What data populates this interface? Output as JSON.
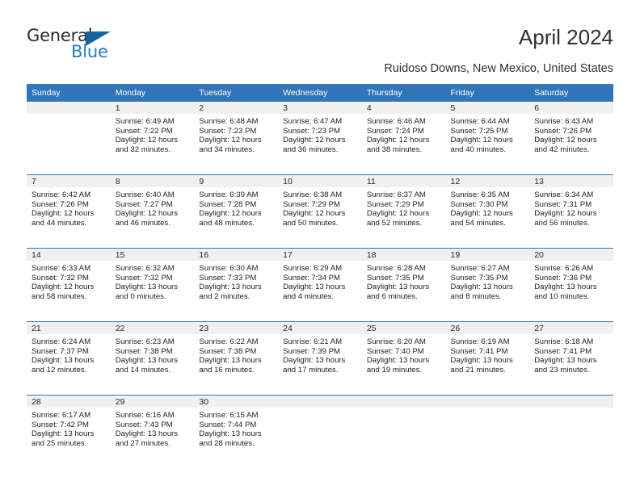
{
  "brand": {
    "name_part1": "General",
    "name_part2": "Blue",
    "accent_color": "#1464a5"
  },
  "header": {
    "title": "April 2024",
    "location": "Ruidoso Downs, New Mexico, United States"
  },
  "calendar": {
    "header_bg": "#3076b8",
    "weekday_headers": [
      "Sunday",
      "Monday",
      "Tuesday",
      "Wednesday",
      "Thursday",
      "Friday",
      "Saturday"
    ],
    "weeks": [
      [
        {
          "day": "",
          "sunrise": "",
          "sunset": "",
          "daylight_line1": "",
          "daylight_line2": ""
        },
        {
          "day": "1",
          "sunrise": "Sunrise: 6:49 AM",
          "sunset": "Sunset: 7:22 PM",
          "daylight_line1": "Daylight: 12 hours",
          "daylight_line2": "and 32 minutes."
        },
        {
          "day": "2",
          "sunrise": "Sunrise: 6:48 AM",
          "sunset": "Sunset: 7:23 PM",
          "daylight_line1": "Daylight: 12 hours",
          "daylight_line2": "and 34 minutes."
        },
        {
          "day": "3",
          "sunrise": "Sunrise: 6:47 AM",
          "sunset": "Sunset: 7:23 PM",
          "daylight_line1": "Daylight: 12 hours",
          "daylight_line2": "and 36 minutes."
        },
        {
          "day": "4",
          "sunrise": "Sunrise: 6:46 AM",
          "sunset": "Sunset: 7:24 PM",
          "daylight_line1": "Daylight: 12 hours",
          "daylight_line2": "and 38 minutes."
        },
        {
          "day": "5",
          "sunrise": "Sunrise: 6:44 AM",
          "sunset": "Sunset: 7:25 PM",
          "daylight_line1": "Daylight: 12 hours",
          "daylight_line2": "and 40 minutes."
        },
        {
          "day": "6",
          "sunrise": "Sunrise: 6:43 AM",
          "sunset": "Sunset: 7:26 PM",
          "daylight_line1": "Daylight: 12 hours",
          "daylight_line2": "and 42 minutes."
        }
      ],
      [
        {
          "day": "7",
          "sunrise": "Sunrise: 6:42 AM",
          "sunset": "Sunset: 7:26 PM",
          "daylight_line1": "Daylight: 12 hours",
          "daylight_line2": "and 44 minutes."
        },
        {
          "day": "8",
          "sunrise": "Sunrise: 6:40 AM",
          "sunset": "Sunset: 7:27 PM",
          "daylight_line1": "Daylight: 12 hours",
          "daylight_line2": "and 46 minutes."
        },
        {
          "day": "9",
          "sunrise": "Sunrise: 6:39 AM",
          "sunset": "Sunset: 7:28 PM",
          "daylight_line1": "Daylight: 12 hours",
          "daylight_line2": "and 48 minutes."
        },
        {
          "day": "10",
          "sunrise": "Sunrise: 6:38 AM",
          "sunset": "Sunset: 7:29 PM",
          "daylight_line1": "Daylight: 12 hours",
          "daylight_line2": "and 50 minutes."
        },
        {
          "day": "11",
          "sunrise": "Sunrise: 6:37 AM",
          "sunset": "Sunset: 7:29 PM",
          "daylight_line1": "Daylight: 12 hours",
          "daylight_line2": "and 52 minutes."
        },
        {
          "day": "12",
          "sunrise": "Sunrise: 6:35 AM",
          "sunset": "Sunset: 7:30 PM",
          "daylight_line1": "Daylight: 12 hours",
          "daylight_line2": "and 54 minutes."
        },
        {
          "day": "13",
          "sunrise": "Sunrise: 6:34 AM",
          "sunset": "Sunset: 7:31 PM",
          "daylight_line1": "Daylight: 12 hours",
          "daylight_line2": "and 56 minutes."
        }
      ],
      [
        {
          "day": "14",
          "sunrise": "Sunrise: 6:33 AM",
          "sunset": "Sunset: 7:32 PM",
          "daylight_line1": "Daylight: 12 hours",
          "daylight_line2": "and 58 minutes."
        },
        {
          "day": "15",
          "sunrise": "Sunrise: 6:32 AM",
          "sunset": "Sunset: 7:32 PM",
          "daylight_line1": "Daylight: 13 hours",
          "daylight_line2": "and 0 minutes."
        },
        {
          "day": "16",
          "sunrise": "Sunrise: 6:30 AM",
          "sunset": "Sunset: 7:33 PM",
          "daylight_line1": "Daylight: 13 hours",
          "daylight_line2": "and 2 minutes."
        },
        {
          "day": "17",
          "sunrise": "Sunrise: 6:29 AM",
          "sunset": "Sunset: 7:34 PM",
          "daylight_line1": "Daylight: 13 hours",
          "daylight_line2": "and 4 minutes."
        },
        {
          "day": "18",
          "sunrise": "Sunrise: 6:28 AM",
          "sunset": "Sunset: 7:35 PM",
          "daylight_line1": "Daylight: 13 hours",
          "daylight_line2": "and 6 minutes."
        },
        {
          "day": "19",
          "sunrise": "Sunrise: 6:27 AM",
          "sunset": "Sunset: 7:35 PM",
          "daylight_line1": "Daylight: 13 hours",
          "daylight_line2": "and 8 minutes."
        },
        {
          "day": "20",
          "sunrise": "Sunrise: 6:26 AM",
          "sunset": "Sunset: 7:36 PM",
          "daylight_line1": "Daylight: 13 hours",
          "daylight_line2": "and 10 minutes."
        }
      ],
      [
        {
          "day": "21",
          "sunrise": "Sunrise: 6:24 AM",
          "sunset": "Sunset: 7:37 PM",
          "daylight_line1": "Daylight: 13 hours",
          "daylight_line2": "and 12 minutes."
        },
        {
          "day": "22",
          "sunrise": "Sunrise: 6:23 AM",
          "sunset": "Sunset: 7:38 PM",
          "daylight_line1": "Daylight: 13 hours",
          "daylight_line2": "and 14 minutes."
        },
        {
          "day": "23",
          "sunrise": "Sunrise: 6:22 AM",
          "sunset": "Sunset: 7:38 PM",
          "daylight_line1": "Daylight: 13 hours",
          "daylight_line2": "and 16 minutes."
        },
        {
          "day": "24",
          "sunrise": "Sunrise: 6:21 AM",
          "sunset": "Sunset: 7:39 PM",
          "daylight_line1": "Daylight: 13 hours",
          "daylight_line2": "and 17 minutes."
        },
        {
          "day": "25",
          "sunrise": "Sunrise: 6:20 AM",
          "sunset": "Sunset: 7:40 PM",
          "daylight_line1": "Daylight: 13 hours",
          "daylight_line2": "and 19 minutes."
        },
        {
          "day": "26",
          "sunrise": "Sunrise: 6:19 AM",
          "sunset": "Sunset: 7:41 PM",
          "daylight_line1": "Daylight: 13 hours",
          "daylight_line2": "and 21 minutes."
        },
        {
          "day": "27",
          "sunrise": "Sunrise: 6:18 AM",
          "sunset": "Sunset: 7:41 PM",
          "daylight_line1": "Daylight: 13 hours",
          "daylight_line2": "and 23 minutes."
        }
      ],
      [
        {
          "day": "28",
          "sunrise": "Sunrise: 6:17 AM",
          "sunset": "Sunset: 7:42 PM",
          "daylight_line1": "Daylight: 13 hours",
          "daylight_line2": "and 25 minutes."
        },
        {
          "day": "29",
          "sunrise": "Sunrise: 6:16 AM",
          "sunset": "Sunset: 7:43 PM",
          "daylight_line1": "Daylight: 13 hours",
          "daylight_line2": "and 27 minutes."
        },
        {
          "day": "30",
          "sunrise": "Sunrise: 6:15 AM",
          "sunset": "Sunset: 7:44 PM",
          "daylight_line1": "Daylight: 13 hours",
          "daylight_line2": "and 28 minutes."
        },
        {
          "day": "",
          "sunrise": "",
          "sunset": "",
          "daylight_line1": "",
          "daylight_line2": ""
        },
        {
          "day": "",
          "sunrise": "",
          "sunset": "",
          "daylight_line1": "",
          "daylight_line2": ""
        },
        {
          "day": "",
          "sunrise": "",
          "sunset": "",
          "daylight_line1": "",
          "daylight_line2": ""
        },
        {
          "day": "",
          "sunrise": "",
          "sunset": "",
          "daylight_line1": "",
          "daylight_line2": ""
        }
      ]
    ]
  }
}
